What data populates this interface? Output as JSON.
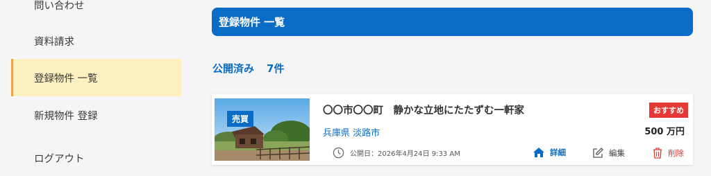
{
  "sidebar": {
    "items": [
      {
        "label": "問い合わせ"
      },
      {
        "label": "資料請求"
      },
      {
        "label": "登録物件 一覧",
        "active": true
      },
      {
        "label": "新規物件 登録"
      },
      {
        "label": "ログアウト"
      }
    ]
  },
  "main": {
    "header_title": "登録物件 一覧",
    "published_label": "公開済み",
    "published_count": "7件"
  },
  "listing": {
    "badge_type": "売買",
    "title": "〇〇市〇〇町　静かな立地にたたずむ一軒家",
    "recommend_badge": "おすすめ",
    "location": "兵庫県 淡路市",
    "price": "500 万円",
    "published_date": "公開日：2026年4月24日 9:33 AM",
    "actions": {
      "detail": "詳細",
      "edit": "編集",
      "delete": "削除"
    }
  },
  "colors": {
    "accent_blue": "#0b6cc5",
    "active_item_bg": "#fdf0c0",
    "active_item_border": "#f0a24a",
    "danger_red": "#e53935"
  },
  "icons": {
    "clock": "clock-icon",
    "detail": "home-icon",
    "edit": "pencil-square-icon",
    "delete": "trash-icon"
  }
}
